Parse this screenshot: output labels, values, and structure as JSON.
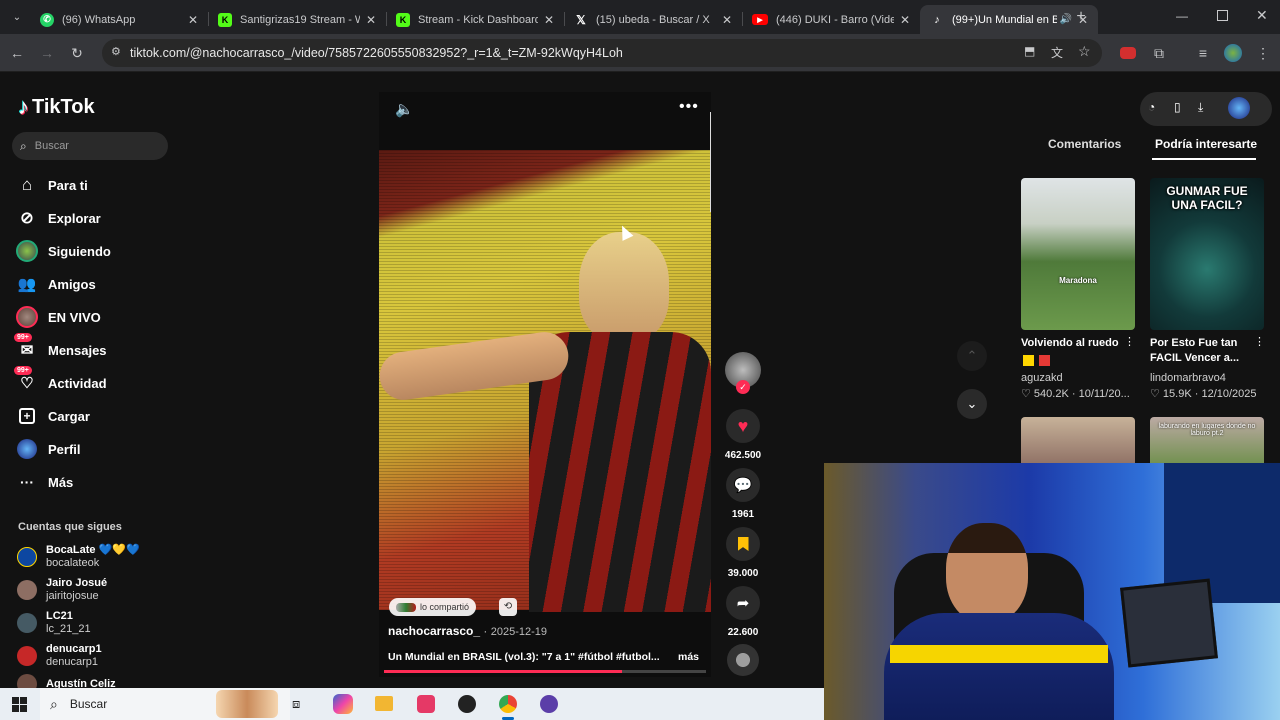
{
  "browser": {
    "tabs": [
      {
        "title": "(96) WhatsApp",
        "icon": "whatsapp-icon",
        "color": "#25d366"
      },
      {
        "title": "Santigrizas19 Stream - Wa",
        "icon": "kick-icon",
        "color": "#53fc18"
      },
      {
        "title": "Stream - Kick Dashboard",
        "icon": "kick-icon",
        "color": "#53fc18"
      },
      {
        "title": "(15) ubeda - Buscar / X",
        "icon": "x-icon",
        "color": "#ffffff"
      },
      {
        "title": "(446) DUKI - Barro (Video",
        "icon": "youtube-icon",
        "color": "#ff0000"
      },
      {
        "title": "(99+)Un Mundial en B",
        "icon": "tiktok-icon",
        "color": "#ffffff"
      }
    ],
    "url": "tiktok.com/@nachocarrasco_/video/7585722605550832952?_r=1&_t=ZM-92kWqyH4Loh"
  },
  "sidebar": {
    "logo": "TikTok",
    "search_placeholder": "Buscar",
    "nav": [
      {
        "label": "Para ti",
        "icon": "home-icon"
      },
      {
        "label": "Explorar",
        "icon": "compass-icon"
      },
      {
        "label": "Siguiendo",
        "icon": "following-avatar-icon"
      },
      {
        "label": "Amigos",
        "icon": "friends-icon"
      },
      {
        "label": "EN VIVO",
        "icon": "live-avatar-icon"
      },
      {
        "label": "Mensajes",
        "icon": "messages-icon",
        "badge": "99+"
      },
      {
        "label": "Actividad",
        "icon": "activity-icon",
        "badge": "99+"
      },
      {
        "label": "Cargar",
        "icon": "upload-icon"
      },
      {
        "label": "Perfil",
        "icon": "profile-avatar-icon"
      },
      {
        "label": "Más",
        "icon": "more-icon"
      }
    ],
    "following_title": "Cuentas que sigues",
    "following": [
      {
        "name": "BocaLate 💙💛💙",
        "handle": "bocalateok"
      },
      {
        "name": "Jairo Josué",
        "handle": "jairitojosue"
      },
      {
        "name": "LC21",
        "handle": "lc_21_21"
      },
      {
        "name": "denucarp1",
        "handle": "denucarp1"
      },
      {
        "name": "Agustín Celiz",
        "handle": ""
      }
    ]
  },
  "video": {
    "shared_by": "lo compartió",
    "author": "nachocarrasco_",
    "date": "2025-12-19",
    "caption": "Un Mundial en BRASIL (vol.3): \"7 a 1\" #fútbol #futbol...",
    "more": "más",
    "progress": 0.74,
    "likes": "462.500",
    "comments": "1961",
    "saves": "39.000",
    "shares": "22.600"
  },
  "right_panel": {
    "tabs": [
      "Comentarios",
      "Podría interesarte"
    ],
    "active_tab": "Podría interesarte",
    "cards": [
      {
        "title": "Volviendo al ruedo",
        "author": "aguzakd",
        "likes": "540.2K",
        "date": "10/11/20...",
        "overlay": "Maradona"
      },
      {
        "title": "Por Esto Fue tan FACIL Vencer a...",
        "author": "lindomarbravo4",
        "likes": "15.9K",
        "date": "12/10/2025",
        "overlay": "GUNMAR FUE UNA FACIL?"
      },
      {
        "title": "",
        "author": "",
        "likes": "",
        "date": "",
        "overlay": ""
      },
      {
        "title": "",
        "author": "",
        "likes": "",
        "date": "",
        "overlay": "laburando en lugares donde no laburo pt.2"
      }
    ]
  },
  "taskbar": {
    "search_placeholder": "Buscar"
  },
  "colors": {
    "accent": "#fe2c55",
    "background": "#121212"
  }
}
